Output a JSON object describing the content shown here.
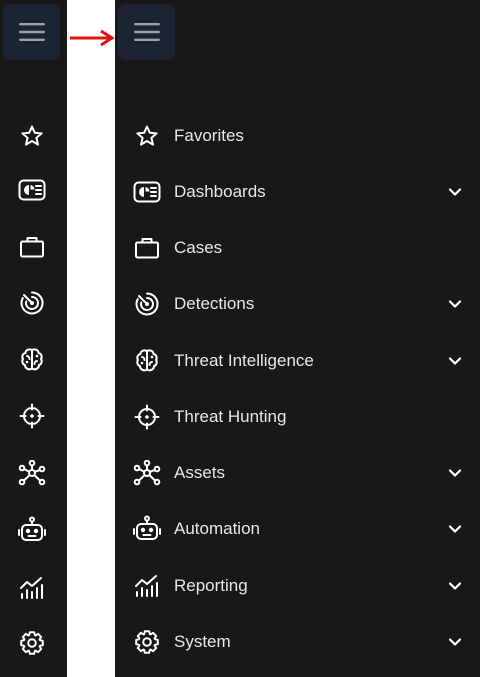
{
  "nav": {
    "items": [
      {
        "label": "Favorites",
        "icon": "star-icon",
        "expandable": false
      },
      {
        "label": "Dashboards",
        "icon": "dashboard-icon",
        "expandable": true
      },
      {
        "label": "Cases",
        "icon": "briefcase-icon",
        "expandable": false
      },
      {
        "label": "Detections",
        "icon": "radar-icon",
        "expandable": true
      },
      {
        "label": "Threat Intelligence",
        "icon": "brain-icon",
        "expandable": true
      },
      {
        "label": "Threat Hunting",
        "icon": "crosshair-icon",
        "expandable": false
      },
      {
        "label": "Assets",
        "icon": "network-icon",
        "expandable": true
      },
      {
        "label": "Automation",
        "icon": "robot-icon",
        "expandable": true
      },
      {
        "label": "Reporting",
        "icon": "chart-icon",
        "expandable": true
      },
      {
        "label": "System",
        "icon": "gear-icon",
        "expandable": true
      }
    ]
  },
  "colors": {
    "sidebar_bg": "#181818",
    "menu_button_bg": "#1b2433",
    "text": "#e8e8e8",
    "icon": "#ffffff",
    "arrow": "#e01010"
  }
}
